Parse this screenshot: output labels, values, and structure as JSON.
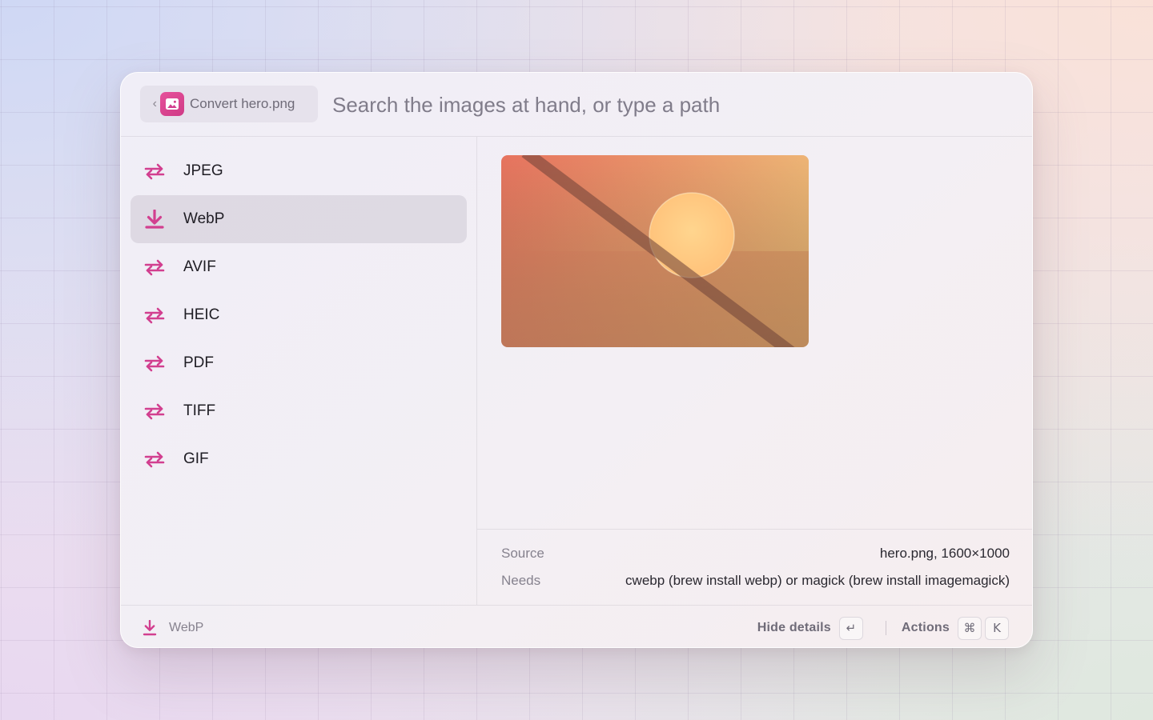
{
  "header": {
    "back_label": "‹",
    "command_label": "Convert hero.png",
    "search_placeholder": "Search the images at hand, or type a path",
    "search_value": ""
  },
  "formats": [
    {
      "label": "JPEG",
      "icon": "convert-arrows-icon",
      "selected": false
    },
    {
      "label": "WebP",
      "icon": "download-icon",
      "selected": true
    },
    {
      "label": "AVIF",
      "icon": "convert-arrows-icon",
      "selected": false
    },
    {
      "label": "HEIC",
      "icon": "convert-arrows-icon",
      "selected": false
    },
    {
      "label": "PDF",
      "icon": "convert-arrows-icon",
      "selected": false
    },
    {
      "label": "TIFF",
      "icon": "convert-arrows-icon",
      "selected": false
    },
    {
      "label": "GIF",
      "icon": "convert-arrows-icon",
      "selected": false
    }
  ],
  "details": {
    "source_label": "Source",
    "source_value": "hero.png, 1600×1000",
    "needs_label": "Needs",
    "needs_value": "cwebp (brew install webp) or magick (brew install imagemagick)"
  },
  "footer": {
    "selected_label": "WebP",
    "hide_details_label": "Hide details",
    "return_key": "↵",
    "actions_label": "Actions",
    "cmd_key": "⌘",
    "k_key": "K"
  },
  "colors": {
    "accent": "#d23f8f",
    "text_primary": "#1f1d24",
    "text_secondary": "#86828e"
  }
}
